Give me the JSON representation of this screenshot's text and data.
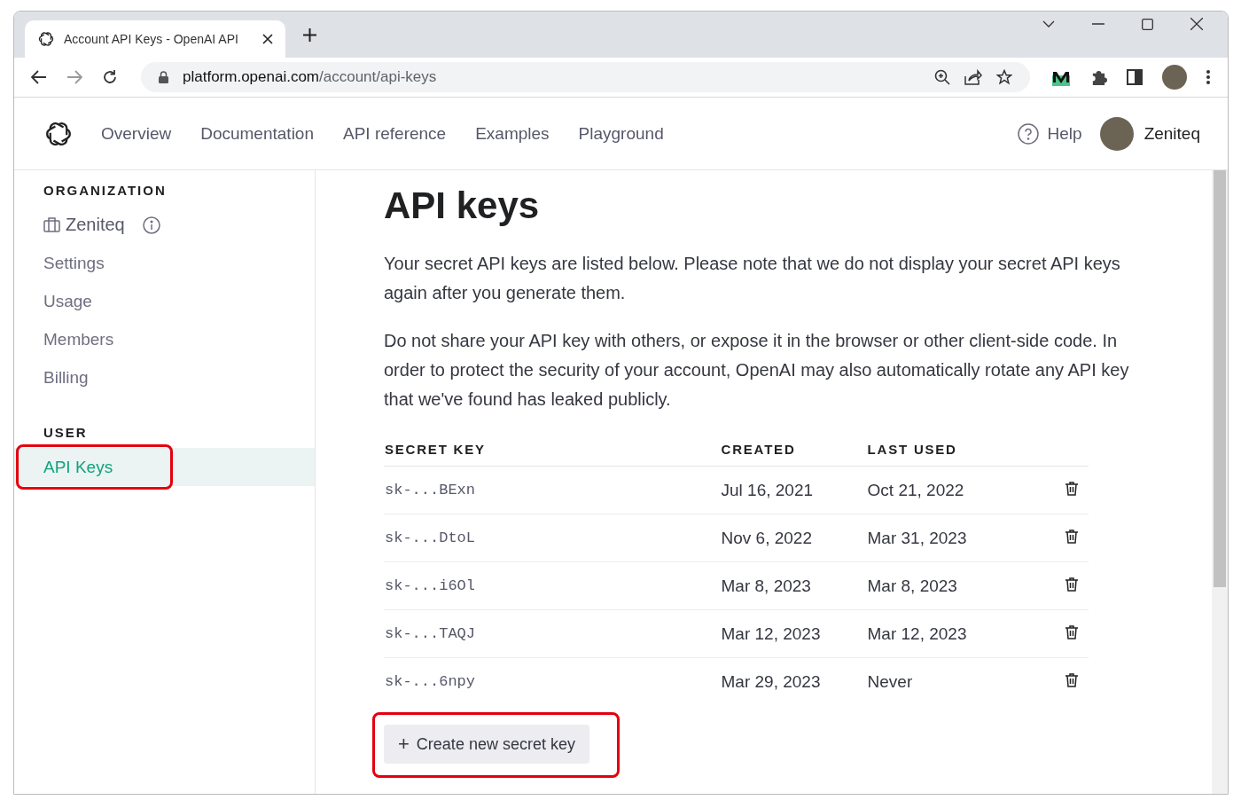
{
  "browser": {
    "tab_title": "Account API Keys - OpenAI API",
    "url_host": "platform.openai.com",
    "url_path": "/account/api-keys"
  },
  "nav": {
    "links": [
      "Overview",
      "Documentation",
      "API reference",
      "Examples",
      "Playground"
    ],
    "help": "Help",
    "user": "Zeniteq"
  },
  "sidebar": {
    "sections": [
      {
        "heading": "ORGANIZATION",
        "items": [
          {
            "label": "Zeniteq",
            "kind": "org",
            "selected": false,
            "annotated": false
          },
          {
            "label": "Settings",
            "kind": "link",
            "selected": false,
            "annotated": false
          },
          {
            "label": "Usage",
            "kind": "link",
            "selected": false,
            "annotated": false
          },
          {
            "label": "Members",
            "kind": "link",
            "selected": false,
            "annotated": false
          },
          {
            "label": "Billing",
            "kind": "link",
            "selected": false,
            "annotated": false
          }
        ]
      },
      {
        "heading": "USER",
        "items": [
          {
            "label": "API Keys",
            "kind": "link",
            "selected": true,
            "annotated": true
          }
        ]
      }
    ]
  },
  "main": {
    "title": "API keys",
    "paragraphs": [
      "Your secret API keys are listed below. Please note that we do not display your secret API keys again after you generate them.",
      "Do not share your API key with others, or expose it in the browser or other client-side code. In order to protect the security of your account, OpenAI may also automatically rotate any API key that we've found has leaked publicly."
    ],
    "table": {
      "columns": [
        "SECRET KEY",
        "CREATED",
        "LAST USED"
      ],
      "rows": [
        {
          "key": "sk-...BExn",
          "created": "Jul 16, 2021",
          "last_used": "Oct 21, 2022"
        },
        {
          "key": "sk-...DtoL",
          "created": "Nov 6, 2022",
          "last_used": "Mar 31, 2023"
        },
        {
          "key": "sk-...i6Ol",
          "created": "Mar 8, 2023",
          "last_used": "Mar 8, 2023"
        },
        {
          "key": "sk-...TAQJ",
          "created": "Mar 12, 2023",
          "last_used": "Mar 12, 2023"
        },
        {
          "key": "sk-...6npy",
          "created": "Mar 29, 2023",
          "last_used": "Never"
        }
      ]
    },
    "create_button": {
      "icon": "+",
      "label": "Create new secret key",
      "annotated": true
    }
  }
}
